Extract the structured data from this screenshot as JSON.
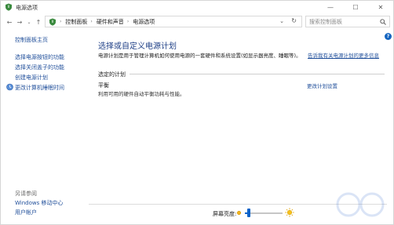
{
  "window": {
    "title": "电源选项",
    "controls": {
      "minimize": "—",
      "maximize": "☐",
      "close": "✕"
    }
  },
  "address": {
    "back": "←",
    "forward": "→",
    "recent": "⌄",
    "up": "↑",
    "breadcrumbs": [
      "控制面板",
      "硬件和声音",
      "电源选项"
    ],
    "separator": "›",
    "dropdown": "⌄",
    "refresh": "↻",
    "search_placeholder": "搜索控制面板"
  },
  "help": {
    "label": "?"
  },
  "sidebar": {
    "home": "控制面板主页",
    "items": [
      "选择电源按钮的功能",
      "选择关闭盖子的功能",
      "创建电源计划",
      "更改计算机睡眠时间"
    ],
    "see_also_heading": "另请参阅",
    "see_also": [
      "Windows 移动中心",
      "用户帐户"
    ]
  },
  "main": {
    "title": "选择或自定义电源计划",
    "description": "电源计划是用于管理计算机如何使用电源的一套硬件和系统设置(如显示器亮度、睡眠等)。",
    "description_link": "告诉我有关电源计划的更多信息",
    "selected_plan_heading": "选定的计划",
    "plan": {
      "name": "平衡",
      "description": "利用可用的硬件自动平衡功耗与性能。",
      "settings_link": "更改计划设置"
    }
  },
  "brightness": {
    "label": "屏幕亮度:",
    "level_percent": 10
  },
  "colors": {
    "accent": "#0b63c9",
    "link": "#1f4e9a",
    "title": "#1e3f86"
  }
}
